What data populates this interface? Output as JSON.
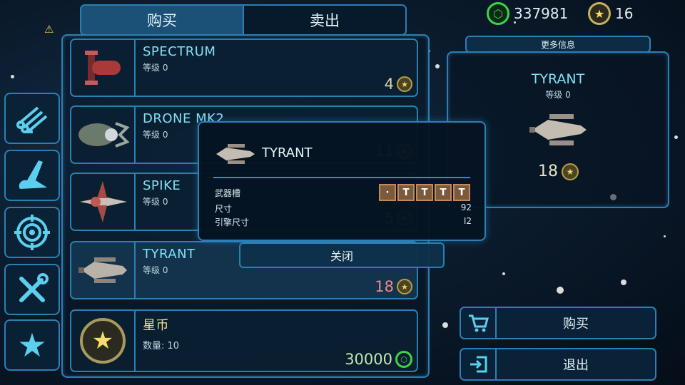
{
  "tabs": {
    "buy": "购买",
    "sell": "卖出"
  },
  "currency": {
    "credits": "337981",
    "credit_icon": "hexagon-credit-icon",
    "stars": "16",
    "star_icon": "star-coin-icon"
  },
  "side_menu": [
    {
      "icon": "pipes-icon"
    },
    {
      "icon": "wing-icon"
    },
    {
      "icon": "target-icon"
    },
    {
      "icon": "tools-icon"
    },
    {
      "icon": "star-icon"
    }
  ],
  "items": [
    {
      "name": "SPECTRUM",
      "level": "等级 0",
      "price": "4",
      "price_icon": "star-coin-icon"
    },
    {
      "name": "DRONE MK2",
      "level": "等级 0",
      "price": "11",
      "price_icon": "star-coin-icon"
    },
    {
      "name": "SPIKE",
      "level": "等级 0",
      "price": "5",
      "price_icon": "star-coin-icon"
    },
    {
      "name": "TYRANT",
      "level": "等级 0",
      "price": "18",
      "price_icon": "star-coin-icon"
    },
    {
      "name": "星币",
      "level": "数量: 10",
      "price": "30000",
      "price_icon": "hexagon-credit-icon"
    }
  ],
  "detail": {
    "more_info": "更多信息",
    "name": "TYRANT",
    "level": "等级 0",
    "price": "18"
  },
  "popup": {
    "name": "TYRANT",
    "weapon_slots_label": "武器槽",
    "slots": [
      "·",
      "T",
      "T",
      "T",
      "T"
    ],
    "size_label": "尺寸",
    "size_value": "92",
    "engine_label": "引擎尺寸",
    "engine_value": "I2",
    "close_label": "关闭"
  },
  "actions": {
    "buy": "购买",
    "exit": "退出"
  },
  "colors": {
    "accent": "#2c7fb3",
    "title": "#7fe0f5",
    "credit": "#3dd24a",
    "star": "#f4d55c"
  }
}
